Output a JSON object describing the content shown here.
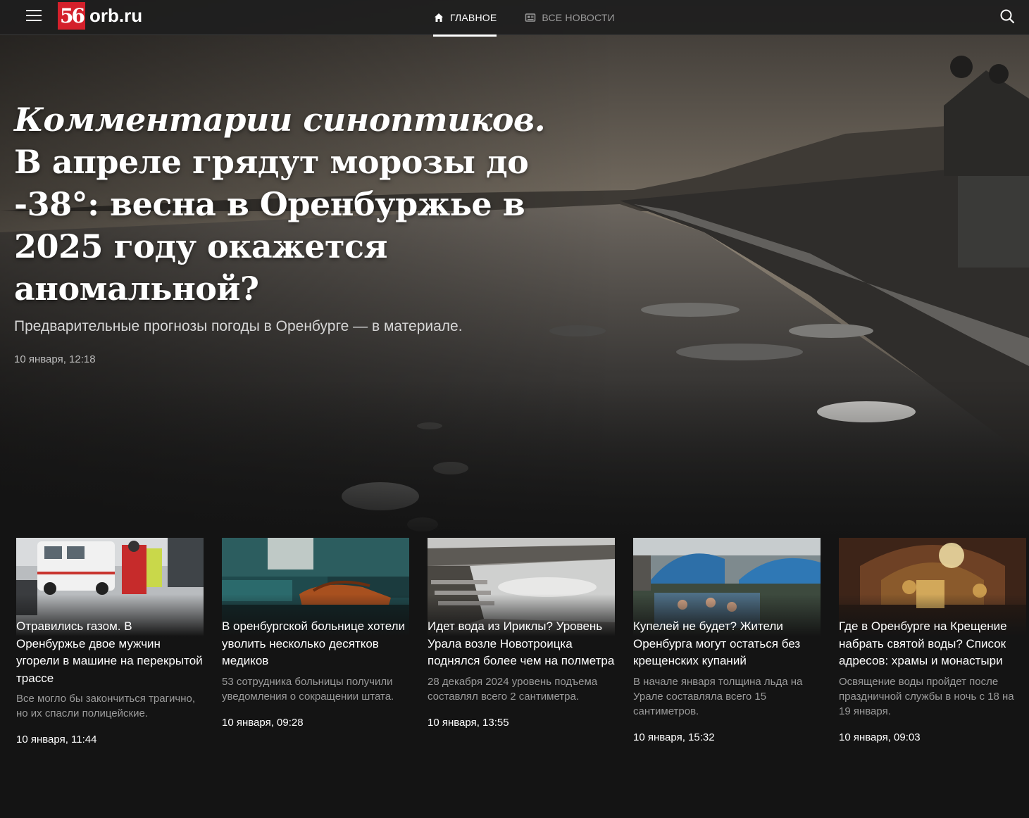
{
  "header": {
    "logo_badge": "56",
    "logo_text": "orb.ru",
    "nav": [
      {
        "label": "ГЛАВНОЕ",
        "icon": "home-icon",
        "active": true
      },
      {
        "label": "ВСЕ НОВОСТИ",
        "icon": "newspaper-icon",
        "active": false
      }
    ],
    "search_icon": "search-icon"
  },
  "hero": {
    "title_italic": "Комментарии синоптиков.",
    "title_rest": " В апреле грядут морозы до -38°: весна в Оренбуржье в 2025 году окажется аномальной?",
    "subtitle": "Предварительные прогнозы погоды в Оренбурге — в материале.",
    "date": "10 января, 12:18"
  },
  "cards": [
    {
      "title": "Отравились газом. В Оренбуржье двое мужчин угорели в машине на перекрытой трассе",
      "lead": "Все могло бы закончиться трагично, но их спасли полицейские.",
      "date": "10 января, 11:44"
    },
    {
      "title": "В оренбургской больнице хотели уволить несколько десятков медиков",
      "lead": "53 сотрудника больницы получили уведомления о сокращении штата.",
      "date": "10 января, 09:28"
    },
    {
      "title": "Идет вода из Ириклы? Уровень Урала возле Новотроицка поднялся более чем на полметра",
      "lead": "28 декабря 2024 уровень подъема составлял всего 2 сантиметра.",
      "date": "10 января, 13:55"
    },
    {
      "title": "Купелей не будет? Жители Оренбурга могут остаться без крещенских купаний",
      "lead": "В начале января толщина льда на Урале составляла всего 15 сантиметров.",
      "date": "10 января, 15:32"
    },
    {
      "title": "Где в Оренбурге на Крещение набрать святой воды? Список адресов: храмы и монастыри",
      "lead": "Освящение воды пройдет после праздничной службы в ночь с 18 на 19 января.",
      "date": "10 января, 09:03"
    }
  ]
}
